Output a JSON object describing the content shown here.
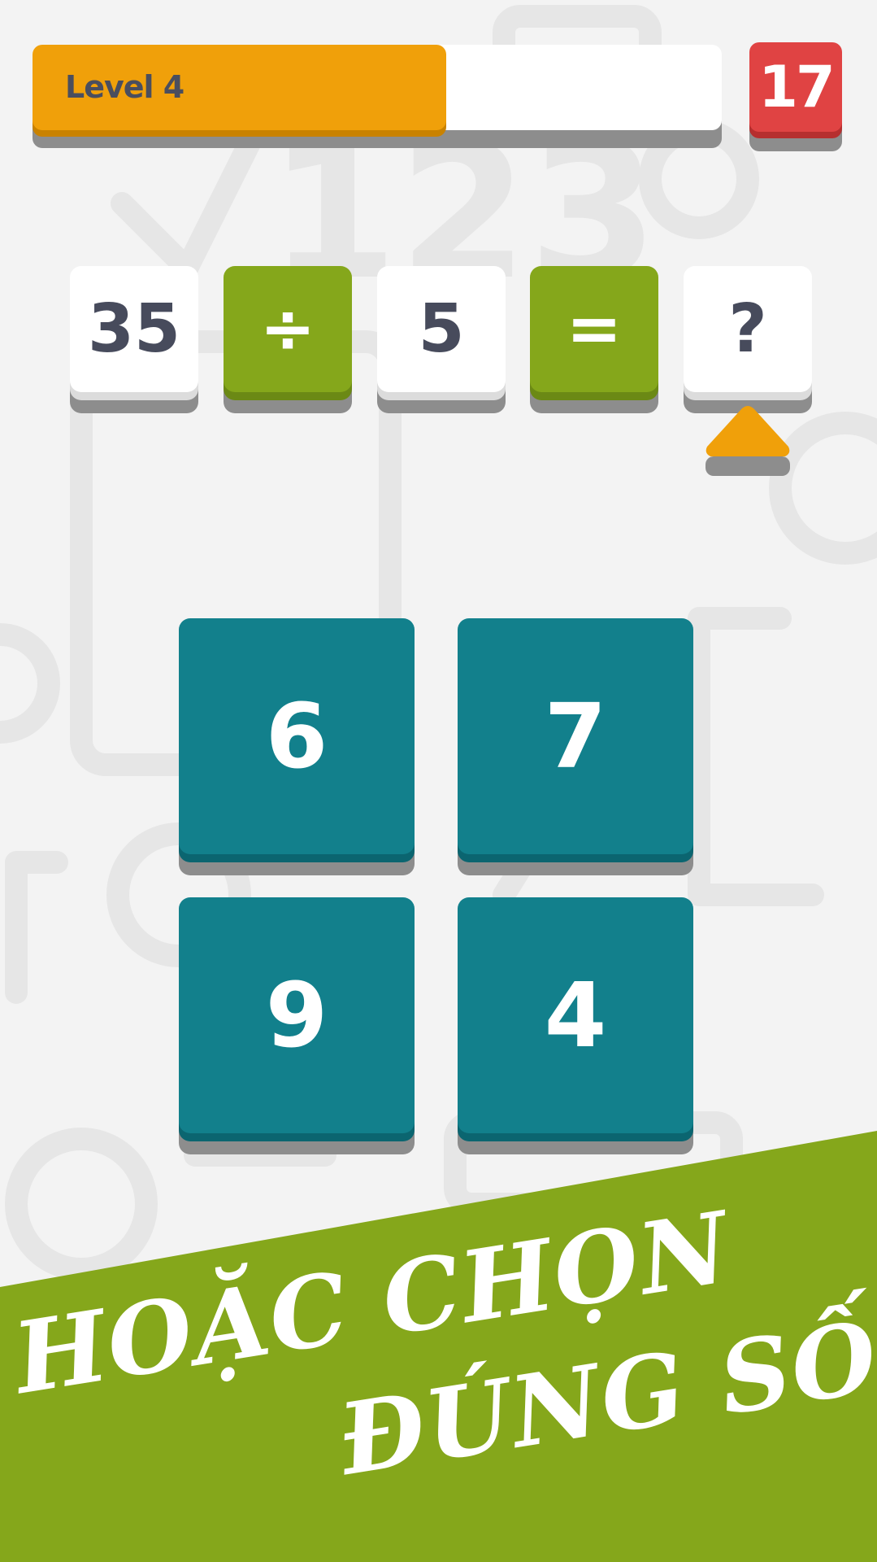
{
  "level": {
    "label": "Level 4",
    "progress": 0.6
  },
  "timer": {
    "value": "17"
  },
  "equation": {
    "tiles": [
      "35",
      "÷",
      "5",
      "=",
      "?"
    ]
  },
  "answers": [
    "6",
    "7",
    "9",
    "4"
  ],
  "banner": {
    "line1": "HOẶC CHỌN",
    "line2": "ĐÚNG SỐ"
  },
  "colors": {
    "accent_orange": "#f0a00a",
    "timer_red": "#e04343",
    "operator_green": "#85a71b",
    "answer_teal": "#12808c",
    "banner_green": "#85a71b"
  }
}
